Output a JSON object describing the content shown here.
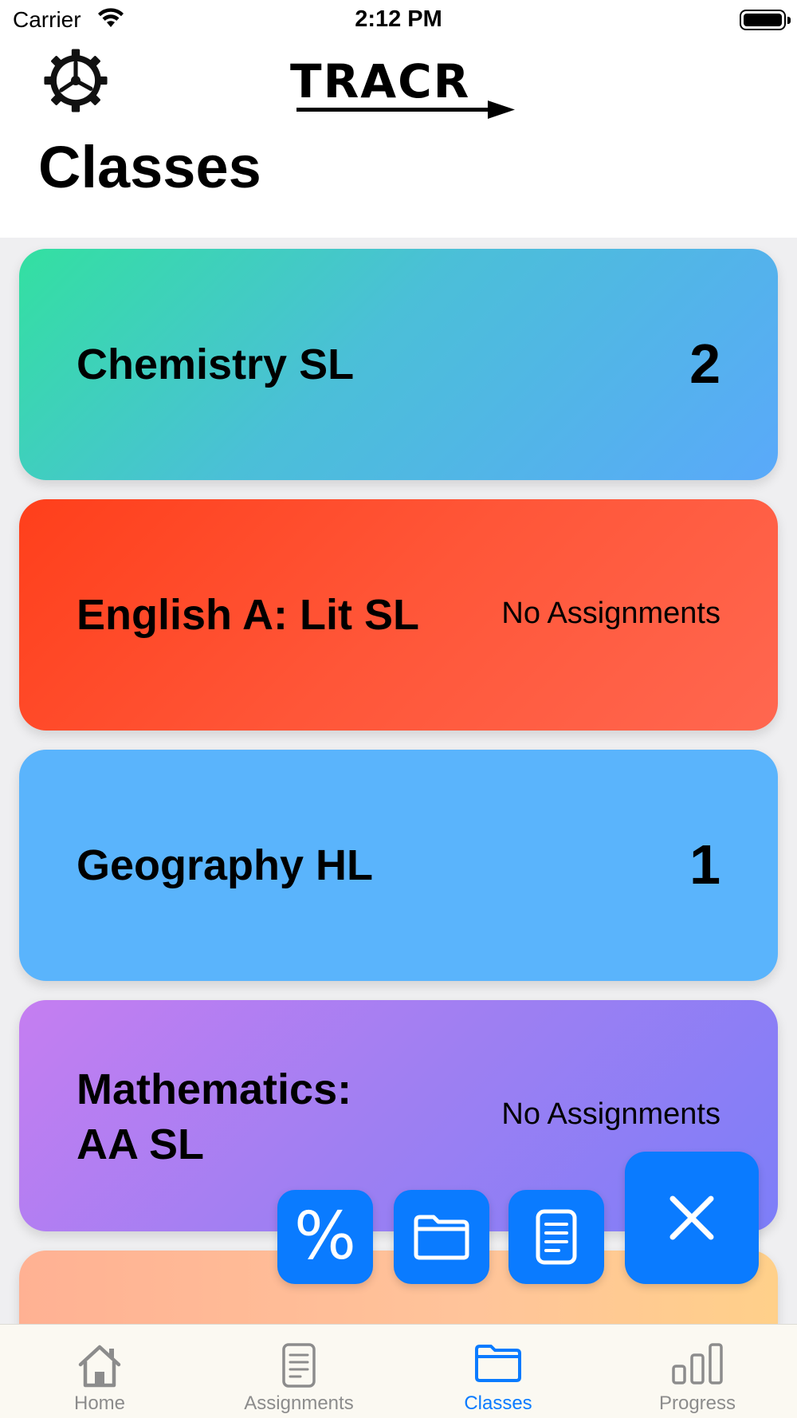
{
  "status_bar": {
    "carrier": "Carrier",
    "time": "2:12 PM"
  },
  "header": {
    "logo_text": "TRACR",
    "title": "Classes"
  },
  "classes": [
    {
      "name": "Chemistry SL",
      "count": "2",
      "status": ""
    },
    {
      "name": "English A: Lit SL",
      "count": "",
      "status": "No Assignments"
    },
    {
      "name": "Geography HL",
      "count": "1",
      "status": ""
    },
    {
      "name_line1": "Mathematics:",
      "name_line2": "AA SL",
      "count": "",
      "status": "No Assignments"
    }
  ],
  "fab": {
    "percent_label": "%"
  },
  "tabbar": {
    "items": [
      {
        "label": "Home",
        "icon": "home-icon"
      },
      {
        "label": "Assignments",
        "icon": "document-icon"
      },
      {
        "label": "Classes",
        "icon": "folder-icon",
        "active": true
      },
      {
        "label": "Progress",
        "icon": "bar-chart-icon"
      }
    ],
    "active_color": "#0a7bff",
    "inactive_color": "#8c8c8c"
  },
  "colors": {
    "chemistry": [
      "#33e0a1",
      "#5aa9fa"
    ],
    "english": [
      "#ff3f1b",
      "#ff6750"
    ],
    "geography": "#5ab4fc",
    "mathematics": [
      "#c57ef1",
      "#7d7ef8"
    ],
    "fab": "#0a7bff"
  }
}
